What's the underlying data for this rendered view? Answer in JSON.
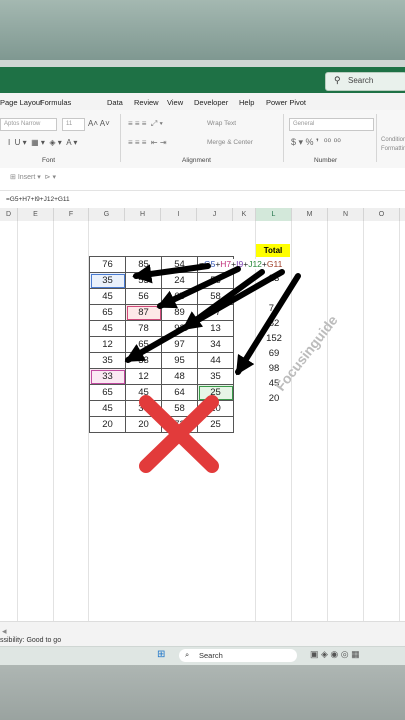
{
  "search": {
    "label": "Search"
  },
  "menu": [
    "Page Layout",
    "Formulas",
    "Data",
    "Review",
    "View",
    "Developer",
    "Help",
    "Power Pivot"
  ],
  "ribbon": {
    "font_name": "Aptos Narrow",
    "font_size": "11",
    "wrap_text": "Wrap Text",
    "merge_center": "Merge & Center",
    "number_format": "General",
    "conditional": "Conditional Formatting",
    "groups": {
      "font": "Font",
      "alignment": "Alignment",
      "number": "Number"
    },
    "insert": "Insert"
  },
  "formula_bar": "=G5+H7+I9+J12+G11",
  "columns": [
    "D",
    "E",
    "F",
    "G",
    "H",
    "I",
    "J",
    "K",
    "L",
    "M",
    "N",
    "O"
  ],
  "selected_column": "L",
  "grid": [
    [
      "76",
      "85",
      "54",
      "45"
    ],
    [
      "35",
      "53",
      "24",
      "56"
    ],
    [
      "45",
      "56",
      "65",
      "58"
    ],
    [
      "65",
      "87",
      "89",
      "77"
    ],
    [
      "45",
      "78",
      "92",
      "13"
    ],
    [
      "12",
      "65",
      "97",
      "34"
    ],
    [
      "35",
      "33",
      "95",
      "44"
    ],
    [
      "33",
      "12",
      "48",
      "35"
    ],
    [
      "65",
      "45",
      "64",
      "25"
    ],
    [
      "45",
      "36",
      "58",
      "10"
    ],
    [
      "20",
      "20",
      "72",
      "25"
    ]
  ],
  "formula_cell": {
    "prefix": "=",
    "parts": [
      "G5",
      "H7",
      "I9",
      "J12",
      "G11"
    ]
  },
  "total": {
    "header": "Total",
    "values": [
      "23",
      "",
      "",
      "74",
      "82",
      "152",
      "69",
      "98",
      "45",
      "20"
    ]
  },
  "watermark": "Focusinguide",
  "status": {
    "accessibility": "ssibility: Good to go"
  },
  "taskbar": {
    "search_label": "Search"
  },
  "colors": {
    "excel_green": "#1e7145",
    "total_highlight": "#ffff00",
    "cross_red": "#e23b3b",
    "arrow": "#000000"
  }
}
